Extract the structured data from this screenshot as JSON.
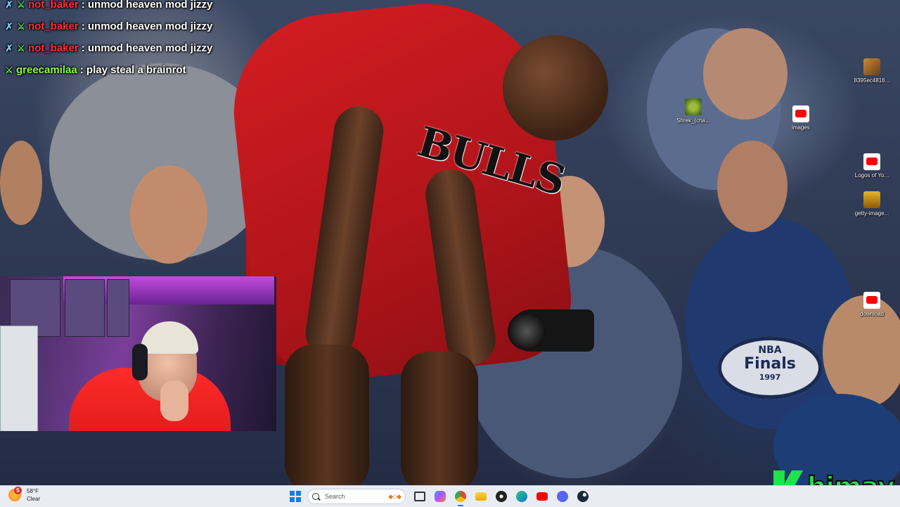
{
  "chat": {
    "messages": [
      {
        "user": "not_baker",
        "user_color": "#ff3030",
        "badges": [
          "sword",
          "mod"
        ],
        "text": "unmod heaven mod jizzy"
      },
      {
        "user": "not_baker",
        "user_color": "#ff3030",
        "badges": [
          "sword",
          "mod"
        ],
        "text": "unmod heaven mod jizzy"
      },
      {
        "user": "not_baker",
        "user_color": "#ff3030",
        "badges": [
          "sword",
          "mod"
        ],
        "text": "unmod heaven mod jizzy"
      },
      {
        "user": "greecamilaa",
        "user_color": "#8bff3a",
        "badges": [
          "mod"
        ],
        "text": "play steal a brainrot"
      }
    ]
  },
  "wallpaper": {
    "jersey_text": "BULLS",
    "banner_text_1": "NBA",
    "banner_text_2": "Finals",
    "banner_text_3": "1997"
  },
  "desktop_icons": [
    {
      "label": "8395ec4816...",
      "icon": "image-file-icon"
    },
    {
      "label": "Shrek_(cha...",
      "icon": "shrek-file-icon"
    },
    {
      "label": "images",
      "icon": "youtube-file-icon"
    },
    {
      "label": "Logos of Yo...",
      "icon": "youtube-file-icon"
    },
    {
      "label": "getty-image...",
      "icon": "getty-file-icon"
    },
    {
      "label": "download",
      "icon": "youtube-file-icon"
    }
  ],
  "logo": {
    "text": "himay",
    "color": "#1fe34a"
  },
  "taskbar": {
    "weather_temp": "58°F",
    "weather_cond": "Clear",
    "weather_badge": "5",
    "search_placeholder": "Search",
    "apps": [
      "task-view",
      "copilot",
      "chrome",
      "file-explorer",
      "obs",
      "edge",
      "youtube",
      "discord",
      "steam"
    ]
  }
}
